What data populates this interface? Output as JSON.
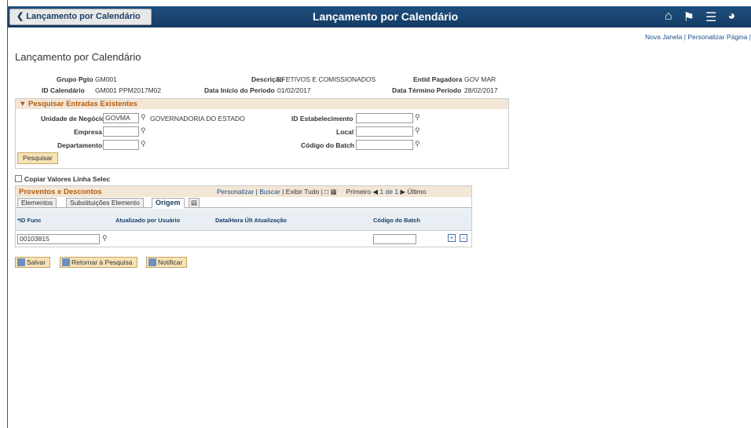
{
  "banner": {
    "back_label": "Lançamento por Calendário",
    "title": "Lançamento por Calendário",
    "icons": [
      "home-icon",
      "flag-icon",
      "menu-icon",
      "compass-icon"
    ]
  },
  "top_links": {
    "new_window": "Nova Janela",
    "sep": "|",
    "personalize": "Personalizar Página",
    "sep2": "|"
  },
  "page_title": "Lançamento por Calendário",
  "header_fields": {
    "grupo_label": "Grupo Pgto",
    "grupo_value": "GM001",
    "descricao_label": "Descrição",
    "descricao_value": "EFETIVOS E COMISSIONADOS",
    "entid_label": "Entid Pagadora",
    "entid_value": "GOV MAR",
    "calendario_label": "ID Calendário",
    "calendario_value": "GM001 PPM2017M02",
    "inicio_label": "Data Início do Período",
    "inicio_value": "01/02/2017",
    "termino_label": "Data Término Período",
    "termino_value": "28/02/2017"
  },
  "search": {
    "title": "Pesquisar Entradas Existentes",
    "unidade_label": "Unidade de Negócio",
    "unidade_value": "GOVMA",
    "unidade_desc": "GOVERNADORIA DO ESTADO",
    "empresa_label": "Empresa",
    "empresa_value": "",
    "departamento_label": "Departamento",
    "departamento_value": "",
    "estab_label": "ID Estabelecimento",
    "estab_value": "",
    "local_label": "Local",
    "local_value": "",
    "batch_label": "Código do Batch",
    "batch_value": "",
    "button": "Pesquisar"
  },
  "copy_label": "Copiar Valores Linha Selec",
  "grid": {
    "title": "Proventos e Descontos",
    "personalize": "Personalizar",
    "sep": "|",
    "find": "Buscar",
    "sep2": "|",
    "view_all": "Exibir Tudo",
    "sep3": "|",
    "first": "Primeiro",
    "range": "1 de 1",
    "last": "Último",
    "tabs": [
      "Elementos",
      "Substituições Elemento",
      "Origem"
    ],
    "columns": [
      "*ID Func",
      "Atualizado por Usuário",
      "Data/Hora Últ Atualização",
      "Código do Batch"
    ],
    "row": {
      "id_func": "00103815",
      "updated_by": "",
      "updated_at": "",
      "batch": ""
    }
  },
  "actions": {
    "save": "Salvar",
    "return": "Retornar à Pesquisa",
    "notify": "Notificar"
  }
}
